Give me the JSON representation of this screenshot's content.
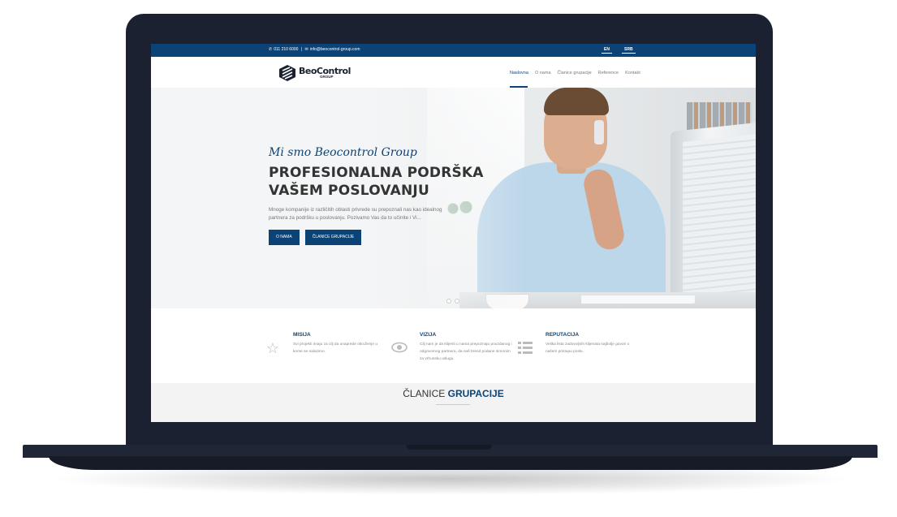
{
  "topbar": {
    "phone": "011 210 6000",
    "email": "info@beocontrol-group.com",
    "lang_en": "EN",
    "lang_srb": "SRB"
  },
  "logo": {
    "name": "BeoControl",
    "subtitle": "GROUP"
  },
  "menu": {
    "items": [
      "Naslovna",
      "O nama",
      "Članice grupacije",
      "Reference",
      "Kontakt"
    ],
    "active": "Naslovna"
  },
  "hero": {
    "subtitle": "Mi smo Beocontrol Group",
    "title_line1": "PROFESIONALNA PODRŠKA",
    "title_line2": "VAŠEM POSLOVANJU",
    "description": "Mnoge kompanije iz različitih oblasti privrede su prepoznali nas kao idealnog partnera za podršku u poslovanju. Pozivamo Vas da to učinite i Vi...",
    "button1": "O NAMA",
    "button2": "ČLANICE GRUPACIJE"
  },
  "features": [
    {
      "icon": "star-icon",
      "title": "MISIJA",
      "desc": "Svi projekti imaju za cilj da unaprede okruženje u kome se nalazimo."
    },
    {
      "icon": "eye-icon",
      "title": "VIZIJA",
      "desc": "Cilj nam je da klijenti u nama prepoznaju pouzdanog i odgovornog partnera, da naš brend podane simonim za vrhunsku uslugu."
    },
    {
      "icon": "list-icon",
      "title": "REPUTACIJA",
      "desc": "Velika lista zadovoljnih klijenata najbolje govori o našem pristupu poslu."
    }
  ],
  "members": {
    "title_light": "ČLANICE",
    "title_bold": "GRUPACIJE"
  },
  "colors": {
    "brand": "#0c4377",
    "laptop": "#1b2131"
  }
}
